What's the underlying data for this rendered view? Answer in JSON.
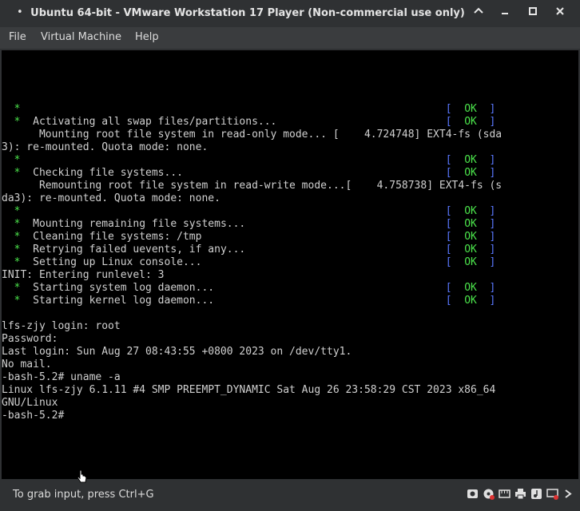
{
  "window": {
    "title": "Ubuntu 64-bit - VMware Workstation 17 Player (Non-commercial use only)",
    "menu": [
      "File",
      "Virtual Machine",
      "Help"
    ]
  },
  "console": {
    "lines": [
      {
        "type": "blank"
      },
      {
        "type": "blank"
      },
      {
        "type": "blank"
      },
      {
        "type": "blank"
      },
      {
        "type": "status",
        "text": "",
        "status": "OK"
      },
      {
        "type": "status",
        "text": "Activating all swap files/partitions...",
        "status": "OK"
      },
      {
        "type": "plain",
        "text": "      Mounting root file system in read-only mode... [    4.724748] EXT4-fs (sda"
      },
      {
        "type": "plain",
        "text": "3): re-mounted. Quota mode: none."
      },
      {
        "type": "status",
        "text": "",
        "status": "OK"
      },
      {
        "type": "status",
        "text": "Checking file systems...",
        "status": "OK"
      },
      {
        "type": "plain",
        "text": "      Remounting root file system in read-write mode...[    4.758738] EXT4-fs (s"
      },
      {
        "type": "plain",
        "text": "da3): re-mounted. Quota mode: none."
      },
      {
        "type": "status",
        "text": "",
        "status": "OK"
      },
      {
        "type": "status",
        "text": "Mounting remaining file systems...",
        "status": "OK"
      },
      {
        "type": "status",
        "text": "Cleaning file systems: /tmp",
        "status": "OK"
      },
      {
        "type": "status",
        "text": "Retrying failed uevents, if any...",
        "status": "OK"
      },
      {
        "type": "status",
        "text": "Setting up Linux console...",
        "status": "OK"
      },
      {
        "type": "plain",
        "text": "INIT: Entering runlevel: 3"
      },
      {
        "type": "status",
        "text": "Starting system log daemon...",
        "status": "OK"
      },
      {
        "type": "status",
        "text": "Starting kernel log daemon...",
        "status": "OK"
      },
      {
        "type": "blank"
      },
      {
        "type": "plain",
        "text": "lfs-zjy login: root"
      },
      {
        "type": "plain",
        "text": "Password:"
      },
      {
        "type": "plain",
        "text": "Last login: Sun Aug 27 08:43:55 +0800 2023 on /dev/tty1."
      },
      {
        "type": "plain",
        "text": "No mail."
      },
      {
        "type": "plain",
        "text": "-bash-5.2# uname -a"
      },
      {
        "type": "plain",
        "text": "Linux lfs-zjy 6.1.11 #4 SMP PREEMPT_DYNAMIC Sat Aug 26 23:58:29 CST 2023 x86_64"
      },
      {
        "type": "plain",
        "text": "GNU/Linux"
      },
      {
        "type": "plain",
        "text": "-bash-5.2#"
      }
    ]
  },
  "status_bar": {
    "hint": "To grab input, press Ctrl+G",
    "device_icons": [
      "hard-disk-icon",
      "cd-dvd-icon",
      "network-adapter-icon",
      "printer-icon",
      "sound-card-icon",
      "display-icon",
      "more-icon"
    ]
  },
  "colors": {
    "ok_bracket": "#5a78ff",
    "ok_text": "#4be34b",
    "star": "#4be34b"
  }
}
